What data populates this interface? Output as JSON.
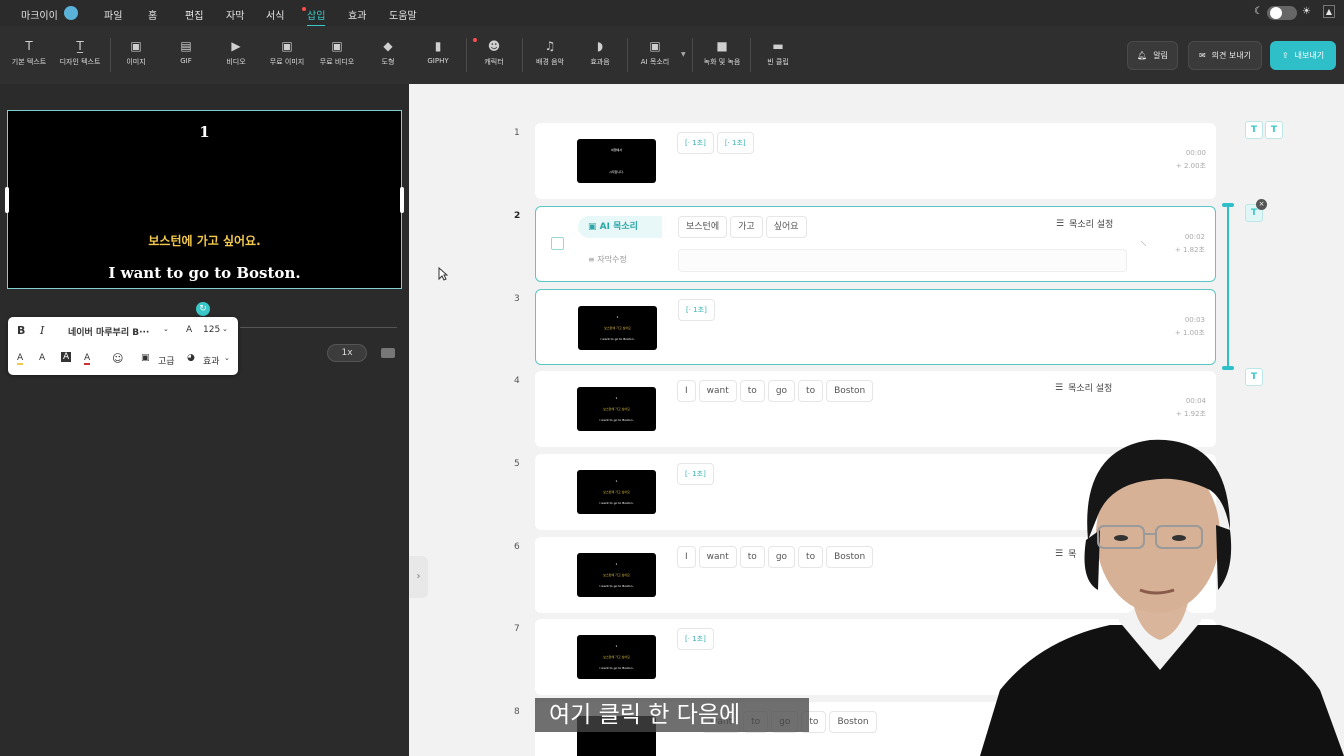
{
  "menu": {
    "brand": "마크이이",
    "items": [
      "파일",
      "홈",
      "편집",
      "자막",
      "서식",
      "삽입",
      "효과",
      "도움말"
    ],
    "active_index": 5
  },
  "toolbar": {
    "items": [
      {
        "label": "기본 텍스트",
        "icon": "text-icon"
      },
      {
        "label": "디자인 텍스트",
        "icon": "design-text-icon"
      },
      {
        "label": "이미지",
        "icon": "image-icon"
      },
      {
        "label": "GIF",
        "icon": "gif-icon"
      },
      {
        "label": "비디오",
        "icon": "video-icon"
      },
      {
        "label": "무료 이미지",
        "icon": "free-image-icon"
      },
      {
        "label": "무료 비디오",
        "icon": "free-video-icon"
      },
      {
        "label": "도형",
        "icon": "shapes-icon"
      },
      {
        "label": "GIPHY",
        "icon": "giphy-icon"
      },
      {
        "label": "캐릭터",
        "icon": "character-icon"
      },
      {
        "label": "배경 음악",
        "icon": "music-icon"
      },
      {
        "label": "효과음",
        "icon": "sound-effect-icon"
      },
      {
        "label": "AI 목소리",
        "icon": "ai-voice-icon"
      },
      {
        "label": "녹화 및 녹음",
        "icon": "record-icon"
      },
      {
        "label": "빈 클립",
        "icon": "blank-clip-icon"
      }
    ],
    "notify": "알림",
    "feedback": "의견 보내기",
    "export": "내보내기"
  },
  "preview": {
    "number": "1",
    "ko": "보스턴에 가고 싶어요.",
    "en": "I want to go to Boston."
  },
  "format": {
    "font": "네이버 마루부리 B···",
    "size": "125",
    "advanced": "고급",
    "effect": "효과",
    "bold": "B",
    "italic": "I"
  },
  "speed": "1x",
  "clips": [
    {
      "num": "1",
      "chips": [
        "[‧ 1초]",
        "[‧ 1초]"
      ],
      "time": "00:00",
      "dur": "+ 2.00초",
      "thumb": [
        "여행에서",
        "시작합니다.",
        ""
      ]
    },
    {
      "num": "2",
      "ai": "AI 목소리",
      "chips": [
        "보스턴에",
        "가고",
        "싶어요"
      ],
      "voice": "목소리 설정",
      "sub": "자막수정",
      "time": "00:02",
      "dur": "+ 1.82초"
    },
    {
      "num": "3",
      "chips": [
        "[‧ 1초]"
      ],
      "time": "00:03",
      "dur": "+ 1.00초",
      "thumb": [
        "1",
        "보스턴에 가고 싶어요",
        "I want to go to Boston."
      ]
    },
    {
      "num": "4",
      "chips": [
        "I",
        "want",
        "to",
        "go",
        "to",
        "Boston"
      ],
      "voice": "목소리 설정",
      "time": "00:04",
      "dur": "+ 1.92초",
      "thumb": [
        "1",
        "보스턴에 가고 싶어요",
        "I want to go to Boston."
      ]
    },
    {
      "num": "5",
      "chips": [
        "[‧ 1초]"
      ],
      "thumb": [
        "1",
        "보스턴에 가고 싶어요",
        "I want to go to Boston."
      ]
    },
    {
      "num": "6",
      "chips": [
        "I",
        "want",
        "to",
        "go",
        "to",
        "Boston"
      ],
      "voice": "목",
      "thumb": [
        "1",
        "보스턴에 가고 싶어요",
        "I want to go to Boston."
      ]
    },
    {
      "num": "7",
      "chips": [
        "[‧ 1초]"
      ],
      "thumb": [
        "1",
        "보스턴에 가고 싶어요",
        "I want to go to Boston."
      ]
    },
    {
      "num": "8",
      "chips": [
        "want",
        "to",
        "go",
        "to",
        "Boston"
      ]
    }
  ],
  "caption": "여기 클릭 한 다음에",
  "colors": {
    "accent": "#2fbfc9",
    "highlight": "#f2c94c"
  }
}
